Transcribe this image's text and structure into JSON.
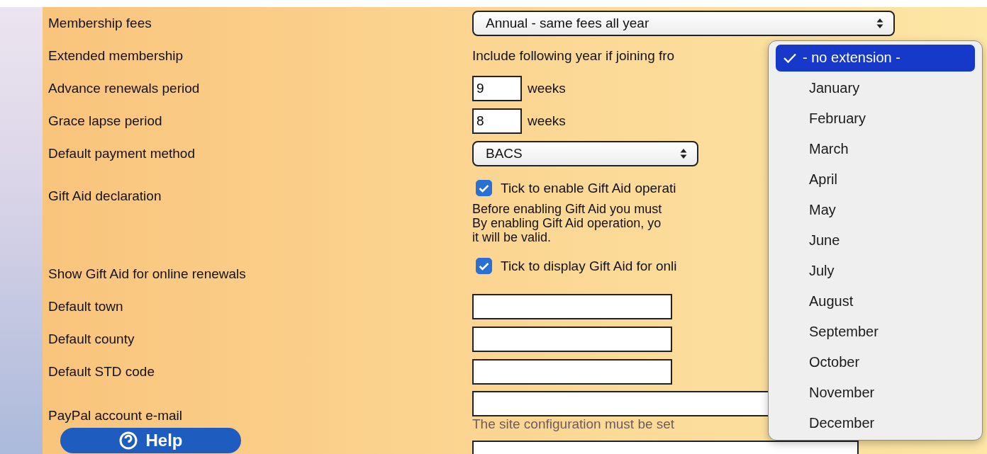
{
  "form": {
    "rows": [
      {
        "kind": "select",
        "label": "Membership fees",
        "value": "Annual - same fees all year",
        "wide": true
      },
      {
        "kind": "text",
        "label": "Extended membership",
        "text": "Include following year if joining fro"
      },
      {
        "kind": "number",
        "label": "Advance renewals period",
        "value": "9",
        "unit": "weeks"
      },
      {
        "kind": "number",
        "label": "Grace lapse period",
        "value": "8",
        "unit": "weeks"
      },
      {
        "kind": "select",
        "label": "Default payment method",
        "value": "BACS",
        "wide": false
      },
      {
        "kind": "checkbox",
        "label": "Gift Aid declaration",
        "checked": true,
        "text": "Tick to enable Gift Aid operati",
        "notes": [
          "Before enabling Gift Aid you must",
          "By enabling Gift Aid operation, yo",
          "it will be valid."
        ]
      },
      {
        "kind": "checkbox",
        "label": "Show Gift Aid for online renewals",
        "checked": true,
        "text": "Tick to display Gift Aid for onli"
      },
      {
        "kind": "input",
        "label": "Default town"
      },
      {
        "kind": "input",
        "label": "Default county"
      },
      {
        "kind": "input",
        "label": "Default STD code"
      },
      {
        "kind": "input_hint",
        "label": "PayPal account e-mail",
        "hint": "The site configuration must be set"
      }
    ]
  },
  "help_button": {
    "label": "Help"
  },
  "dropdown": {
    "items": [
      {
        "label": "- no extension -",
        "selected": true
      },
      {
        "label": "January",
        "selected": false
      },
      {
        "label": "February",
        "selected": false
      },
      {
        "label": "March",
        "selected": false
      },
      {
        "label": "April",
        "selected": false
      },
      {
        "label": "May",
        "selected": false
      },
      {
        "label": "June",
        "selected": false
      },
      {
        "label": "July",
        "selected": false
      },
      {
        "label": "August",
        "selected": false
      },
      {
        "label": "September",
        "selected": false
      },
      {
        "label": "October",
        "selected": false
      },
      {
        "label": "November",
        "selected": false
      },
      {
        "label": "December",
        "selected": false
      }
    ]
  }
}
